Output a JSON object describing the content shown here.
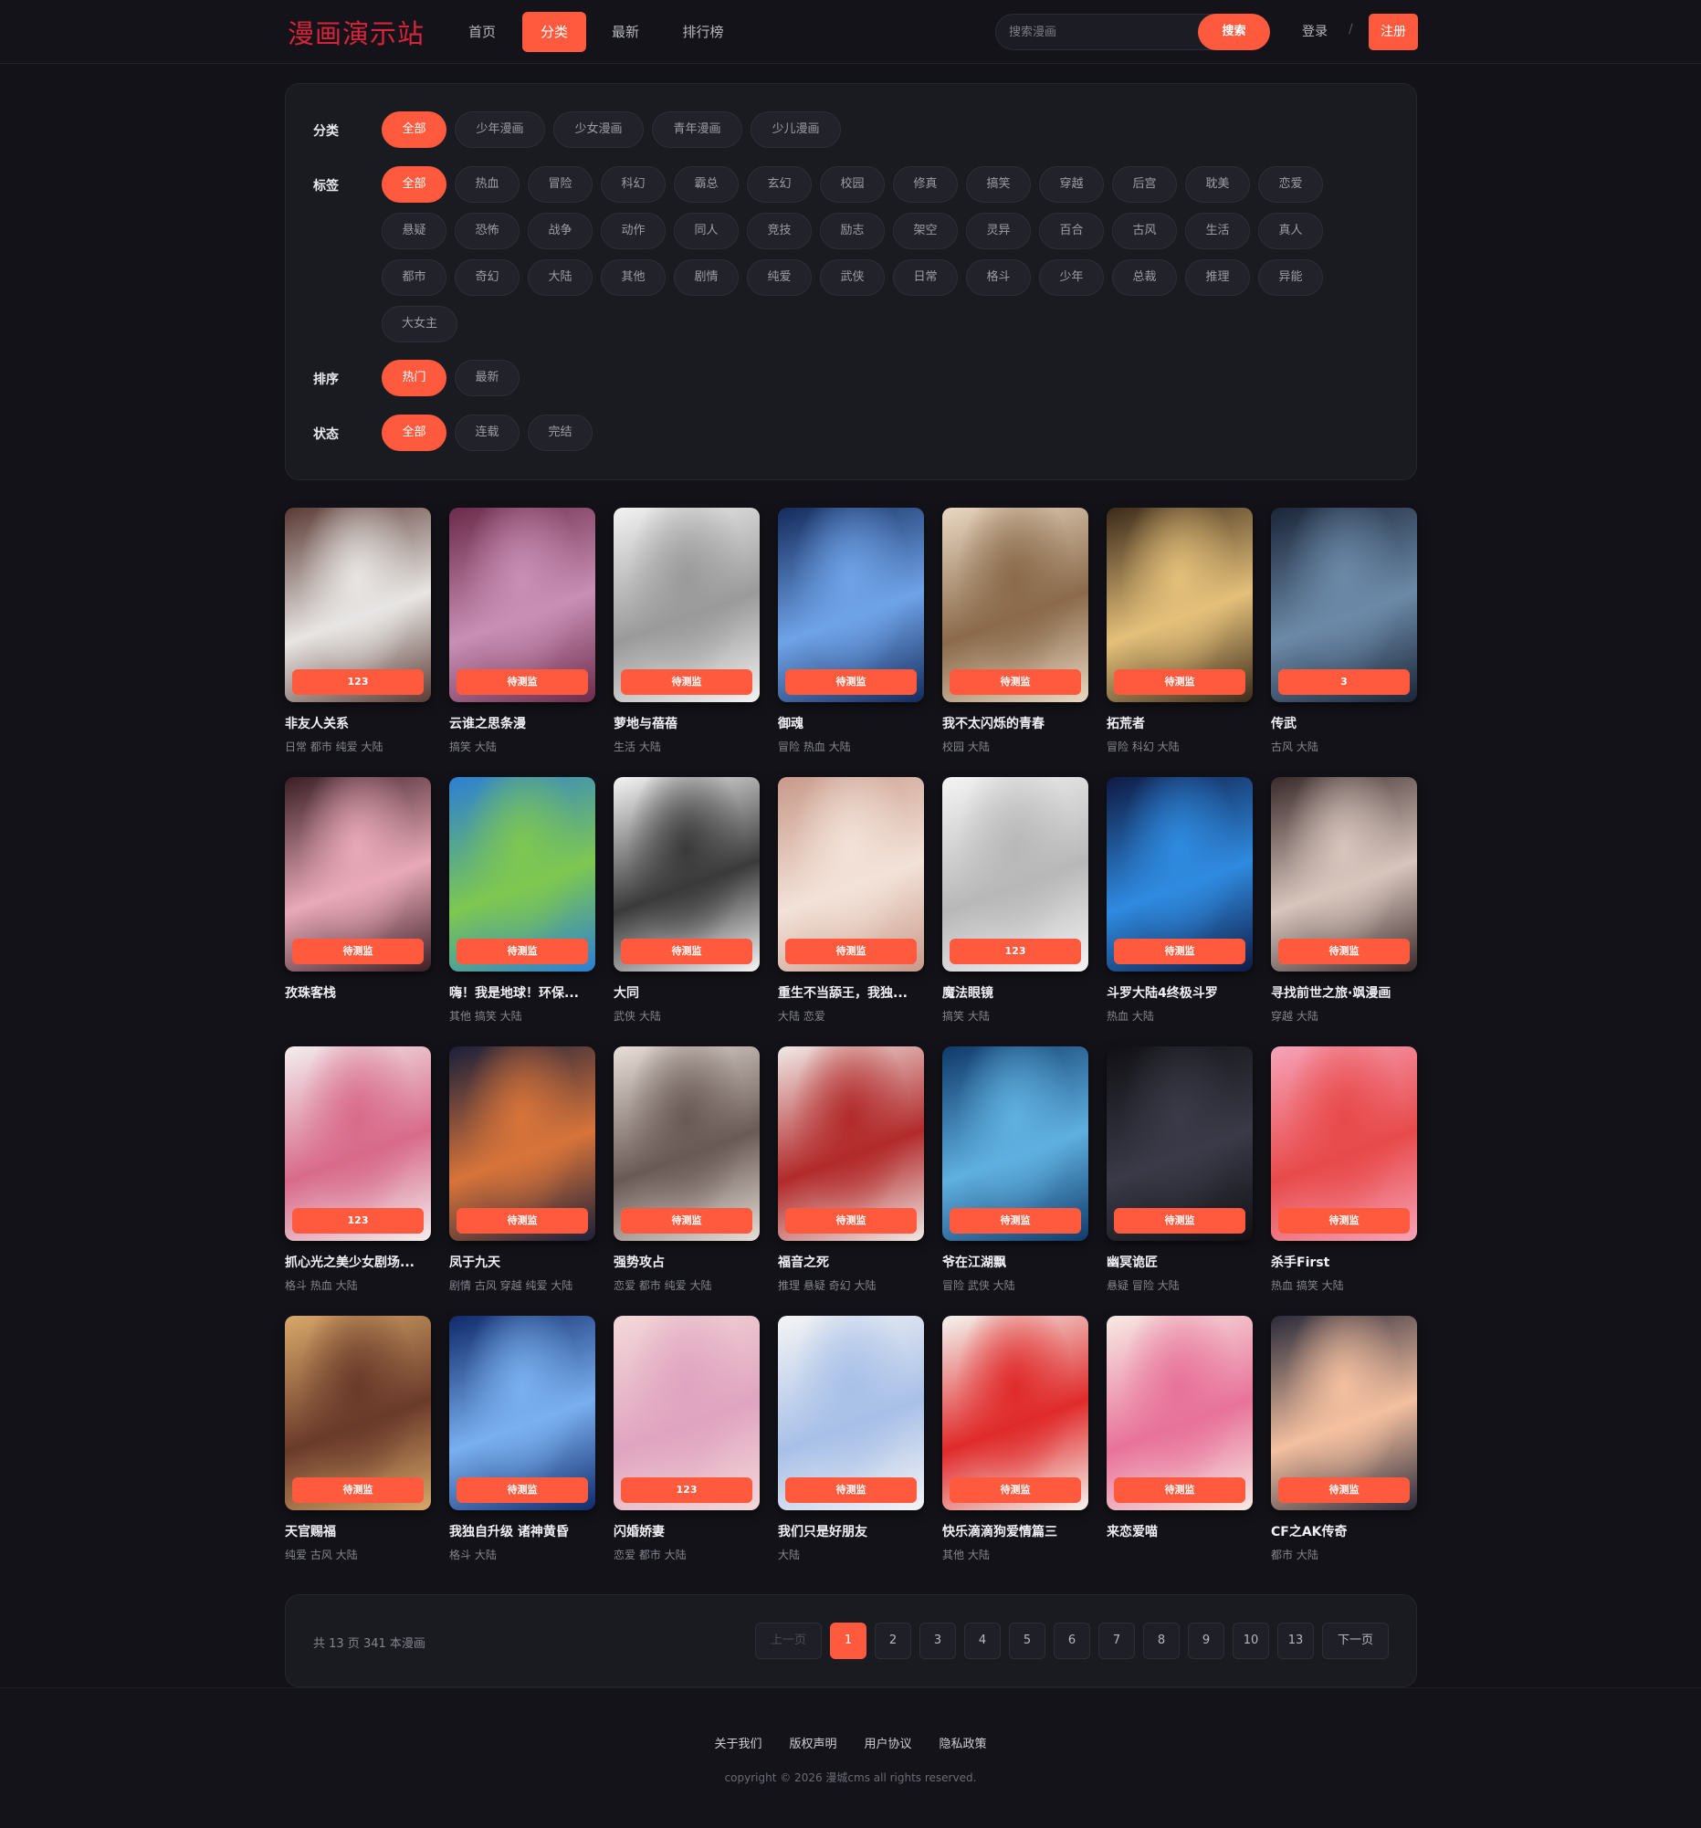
{
  "header": {
    "logo": "漫画演示站",
    "nav": [
      "首页",
      "分类",
      "最新",
      "排行榜"
    ],
    "active_nav": 1,
    "search_placeholder": "搜索漫画",
    "search_button": "搜索",
    "login": "登录",
    "separator": "/",
    "register": "注册"
  },
  "filters": {
    "category_label": "分类",
    "categories": [
      "全部",
      "少年漫画",
      "少女漫画",
      "青年漫画",
      "少儿漫画"
    ],
    "tag_label": "标签",
    "tags": [
      "全部",
      "热血",
      "冒险",
      "科幻",
      "霸总",
      "玄幻",
      "校园",
      "修真",
      "搞笑",
      "穿越",
      "后宫",
      "耽美",
      "恋爱",
      "悬疑",
      "恐怖",
      "战争",
      "动作",
      "同人",
      "竞技",
      "励志",
      "架空",
      "灵异",
      "百合",
      "古风",
      "生活",
      "真人",
      "都市",
      "奇幻",
      "大陆",
      "其他",
      "剧情",
      "纯爱",
      "武侠",
      "日常",
      "格斗",
      "少年",
      "总裁",
      "推理",
      "异能",
      "大女主"
    ],
    "sort_label": "排序",
    "sorts": [
      "热门",
      "最新"
    ],
    "status_label": "状态",
    "statuses": [
      "全部",
      "连载",
      "完结"
    ]
  },
  "comics": [
    {
      "title": "非友人关系",
      "tags": "日常 都市 纯爱 大陆",
      "badge": "123"
    },
    {
      "title": "云谁之思条漫",
      "tags": "搞笑 大陆",
      "badge": "待测监"
    },
    {
      "title": "萝地与蓓蓓",
      "tags": "生活 大陆",
      "badge": "待测监"
    },
    {
      "title": "御魂",
      "tags": "冒险 热血 大陆",
      "badge": "待测监"
    },
    {
      "title": "我不太闪烁的青春",
      "tags": "校园 大陆",
      "badge": "待测监"
    },
    {
      "title": "拓荒者",
      "tags": "冒险 科幻 大陆",
      "badge": "待测监"
    },
    {
      "title": "传武",
      "tags": "古风 大陆",
      "badge": "3"
    },
    {
      "title": "孜珠客栈",
      "tags": "",
      "badge": "待测监"
    },
    {
      "title": "嗨！我是地球！环保...",
      "tags": "其他 搞笑 大陆",
      "badge": "待测监"
    },
    {
      "title": "大同",
      "tags": "武侠 大陆",
      "badge": "待测监"
    },
    {
      "title": "重生不当舔王，我独...",
      "tags": "大陆 恋爱",
      "badge": "待测监"
    },
    {
      "title": "魔法眼镜",
      "tags": "搞笑 大陆",
      "badge": "123"
    },
    {
      "title": "斗罗大陆4终极斗罗",
      "tags": "热血 大陆",
      "badge": "待测监"
    },
    {
      "title": "寻找前世之旅·飒漫画",
      "tags": "穿越 大陆",
      "badge": "待测监"
    },
    {
      "title": "抓心光之美少女剧场...",
      "tags": "格斗 热血 大陆",
      "badge": "123"
    },
    {
      "title": "凤于九天",
      "tags": "剧情 古风 穿越 纯爱 大陆",
      "badge": "待测监"
    },
    {
      "title": "强势攻占",
      "tags": "恋爱 都市 纯爱 大陆",
      "badge": "待测监"
    },
    {
      "title": "福音之死",
      "tags": "推理 悬疑 奇幻 大陆",
      "badge": "待测监"
    },
    {
      "title": "爷在江湖飘",
      "tags": "冒险 武侠 大陆",
      "badge": "待测监"
    },
    {
      "title": "幽冥诡匠",
      "tags": "悬疑 冒险 大陆",
      "badge": "待测监"
    },
    {
      "title": "杀手First",
      "tags": "热血 搞笑 大陆",
      "badge": "待测监"
    },
    {
      "title": "天官赐福",
      "tags": "纯爱 古风 大陆",
      "badge": "待测监"
    },
    {
      "title": "我独自升级 诸神黄昏",
      "tags": "格斗 大陆",
      "badge": "待测监"
    },
    {
      "title": "闪婚娇妻",
      "tags": "恋爱 都市 大陆",
      "badge": "123"
    },
    {
      "title": "我们只是好朋友",
      "tags": "大陆",
      "badge": "待测监"
    },
    {
      "title": "快乐滴滴狗爱情篇三",
      "tags": "其他 大陆",
      "badge": "待测监"
    },
    {
      "title": "来恋爱喵",
      "tags": "",
      "badge": "待测监"
    },
    {
      "title": "CF之AK传奇",
      "tags": "都市 大陆",
      "badge": "待测监"
    }
  ],
  "pagination": {
    "info": "共 13 页 341 本漫画",
    "prev": "上一页",
    "pages": [
      "1",
      "2",
      "3",
      "4",
      "5",
      "6",
      "7",
      "8",
      "9",
      "10",
      "13"
    ],
    "current": "1",
    "next": "下一页"
  },
  "footer": {
    "links": [
      "关于我们",
      "版权声明",
      "用户协议",
      "隐私政策"
    ],
    "copyright": "copyright © 2026 漫城cms all rights reserved."
  },
  "colors": {
    "accent": "#ff5a3d",
    "logo": "#d8243a",
    "background": "#121218",
    "panel": "#1a1a21"
  },
  "cover_palettes": [
    [
      "#5b3a34",
      "#e8e6e4"
    ],
    [
      "#6b2b4a",
      "#c98fb5"
    ],
    [
      "#f2f2f2",
      "#9a9a9a"
    ],
    [
      "#142b5c",
      "#6fa3e8"
    ],
    [
      "#e9d8c2",
      "#8a6a4a"
    ],
    [
      "#3b2a1a",
      "#e4c07a"
    ],
    [
      "#1a2538",
      "#6c8aa8"
    ],
    [
      "#3a1f25",
      "#e9a9b8"
    ],
    [
      "#2b7fd4",
      "#7ec850"
    ],
    [
      "#f5f5f5",
      "#3a3a3a"
    ],
    [
      "#c89a8a",
      "#f3e2d8"
    ],
    [
      "#f4f4f4",
      "#b8b8b8"
    ],
    [
      "#0e1a44",
      "#2f8be0"
    ],
    [
      "#3a2a2a",
      "#d8c6bd"
    ],
    [
      "#f3eeee",
      "#d86a8a"
    ],
    [
      "#1a1f3a",
      "#d8743a"
    ],
    [
      "#e8dfd8",
      "#6a5a55"
    ],
    [
      "#f0e9e6",
      "#b22a2a"
    ],
    [
      "#0f3a6a",
      "#5fb0e0"
    ],
    [
      "#101014",
      "#3a3a48"
    ],
    [
      "#f6a3b8",
      "#e84a4a"
    ],
    [
      "#d8a86a",
      "#6a3a2a"
    ],
    [
      "#0f2a6a",
      "#7ab0f0"
    ],
    [
      "#f3d8d8",
      "#e0a4c0"
    ],
    [
      "#f4f4f4",
      "#a8c0e8"
    ],
    [
      "#f5f5f0",
      "#e02a2a"
    ],
    [
      "#f7eae3",
      "#e8729a"
    ],
    [
      "#2a2a3a",
      "#f4c0a0"
    ]
  ]
}
